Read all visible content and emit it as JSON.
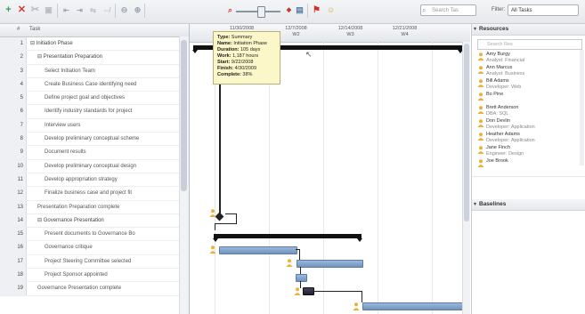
{
  "toolbar": {
    "search_placeholder": "Search Tas",
    "filter_label": "Filter:",
    "filter_value": "All Tasks"
  },
  "grid": {
    "column_header": "Task",
    "rows": [
      {
        "num": "1",
        "name": "⊟ Initiation Phase",
        "indent": 0,
        "summary": true
      },
      {
        "num": "2",
        "name": "⊟ Presentation Preparation",
        "indent": 1,
        "summary": true
      },
      {
        "num": "3",
        "name": "Select Initiation Team",
        "indent": 2
      },
      {
        "num": "4",
        "name": "Create Business Case identifying need",
        "indent": 2
      },
      {
        "num": "5",
        "name": "Define project goal and objectives",
        "indent": 2
      },
      {
        "num": "6",
        "name": "Identify industry standards for project",
        "indent": 2
      },
      {
        "num": "7",
        "name": "Interview users",
        "indent": 2
      },
      {
        "num": "8",
        "name": "Develop preliminary conceptual scheme",
        "indent": 2
      },
      {
        "num": "9",
        "name": "Document results",
        "indent": 2
      },
      {
        "num": "10",
        "name": "Develop preliminary conceptual design",
        "indent": 2
      },
      {
        "num": "11",
        "name": "Develop appropriation strategy",
        "indent": 2
      },
      {
        "num": "12",
        "name": "Finalize business case and project fit",
        "indent": 2
      },
      {
        "num": "13",
        "name": "Presentation Preparation complete",
        "indent": 1
      },
      {
        "num": "14",
        "name": "⊟ Governance Presentation",
        "indent": 1,
        "summary": true
      },
      {
        "num": "15",
        "name": "Present documents to Governance Bo",
        "indent": 2
      },
      {
        "num": "16",
        "name": "Governance critique",
        "indent": 2
      },
      {
        "num": "17",
        "name": "Project Steering Committee selected",
        "indent": 2
      },
      {
        "num": "18",
        "name": "Project Sponsor appointed",
        "indent": 2
      },
      {
        "num": "19",
        "name": "Governance Presentation complete",
        "indent": 1
      }
    ]
  },
  "gantt": {
    "columns": [
      {
        "date": "11/30/2008",
        "label": "W2"
      },
      {
        "date": "12/7/2008",
        "label": "W2"
      },
      {
        "date": "12/14/2008",
        "label": "W3"
      },
      {
        "date": "12/21/2008",
        "label": "W4"
      }
    ],
    "tooltip": {
      "type_label": "Type:",
      "type": "Summary",
      "name_label": "Name:",
      "name": "Initiation Phase",
      "duration_label": "Duration:",
      "duration": "105 days",
      "work_label": "Work:",
      "work": "1,187 hours",
      "start_label": "Start:",
      "start": "9/22/2008",
      "finish_label": "Finish:",
      "finish": "4/30/2009",
      "complete_label": "Complete:",
      "complete": "38%"
    }
  },
  "panel": {
    "resources_title": "Resources",
    "resources_search": "Search Res",
    "resources": [
      {
        "name": "Amy Burgy",
        "title": "Analyst: Financial"
      },
      {
        "name": "Ann Marcus",
        "title": "Analyst: Business"
      },
      {
        "name": "Bill Adams",
        "title": "Developer: Web"
      },
      {
        "name": "Bo Pine",
        "title": ""
      },
      {
        "name": "Brett Anderson",
        "title": "DBA: SQL"
      },
      {
        "name": "Don Devlin",
        "title": "Developer: Application"
      },
      {
        "name": "Heather Adams",
        "title": "Developer: Application"
      },
      {
        "name": "Jane Finch",
        "title": "Engineer: Design"
      },
      {
        "name": "Joe Brook",
        "title": ""
      }
    ],
    "baselines_title": "Baselines",
    "colors": {
      "accent": "#6f93bf",
      "tooltip": "#fbf7c8"
    }
  }
}
